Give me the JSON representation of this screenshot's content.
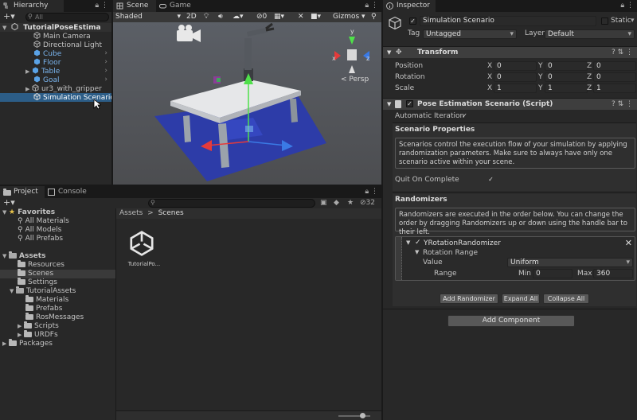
{
  "hierarchy": {
    "tab": "Hierarchy",
    "search_placeholder": "All",
    "scene": "TutorialPoseEstima",
    "items": [
      "Main Camera",
      "Directional Light",
      "Cube",
      "Floor",
      "Table",
      "Goal",
      "ur3_with_gripper",
      "Simulation Scenario"
    ]
  },
  "scene_view": {
    "tab_scene": "Scene",
    "tab_game": "Game",
    "shading": "Shaded",
    "mode_2d": "2D",
    "hidden_count": "0",
    "gizmos": "Gizmos",
    "axis_y": "y",
    "axis_x": "x",
    "axis_z": "z",
    "persp": "Persp"
  },
  "project": {
    "tab_project": "Project",
    "tab_console": "Console",
    "count": "32",
    "favorites": "Favorites",
    "fav_items": [
      "All Materials",
      "All Models",
      "All Prefabs"
    ],
    "assets": "Assets",
    "asset_folders": [
      "Resources",
      "Scenes",
      "Settings"
    ],
    "tutorial_assets": "TutorialAssets",
    "tutorial_sub": [
      "Materials",
      "Prefabs",
      "RosMessages",
      "Scripts",
      "URDFs"
    ],
    "packages": "Packages",
    "breadcrumb_root": "Assets",
    "breadcrumb_sep": ">",
    "breadcrumb_current": "Scenes",
    "file_name": "TutorialPo..."
  },
  "inspector": {
    "tab": "Inspector",
    "object_name": "Simulation Scenario",
    "static_label": "Static",
    "tag_label": "Tag",
    "tag_value": "Untagged",
    "layer_label": "Layer",
    "layer_value": "Default",
    "transform": {
      "title": "Transform",
      "position_label": "Position",
      "rotation_label": "Rotation",
      "scale_label": "Scale",
      "position": [
        "0",
        "0",
        "0"
      ],
      "rotation": [
        "0",
        "0",
        "0"
      ],
      "scale": [
        "1",
        "1",
        "1"
      ],
      "x": "X",
      "y": "Y",
      "z": "Z"
    },
    "script": {
      "title": "Pose Estimation Scenario (Script)",
      "auto_iter": "Automatic Iteration",
      "props_title": "Scenario Properties",
      "props_desc": "Scenarios control the execution flow of your simulation by applying randomization parameters. Make sure to always have only one scenario active within your scene.",
      "quit_label": "Quit On Complete",
      "randomizers_title": "Randomizers",
      "randomizers_desc": "Randomizers are executed in the order below. You can change the order by dragging Randomizers up or down using the handle bar to their left.",
      "randomizer_name": "YRotationRandomizer",
      "rotation_range": "Rotation Range",
      "value_label": "Value",
      "value_option": "Uniform",
      "range_label": "Range",
      "min_label": "Min",
      "min_value": "0",
      "max_label": "Max",
      "max_value": "360",
      "add_randomizer": "Add Randomizer",
      "expand_all": "Expand All",
      "collapse_all": "Collapse All"
    },
    "add_component": "Add Component"
  }
}
